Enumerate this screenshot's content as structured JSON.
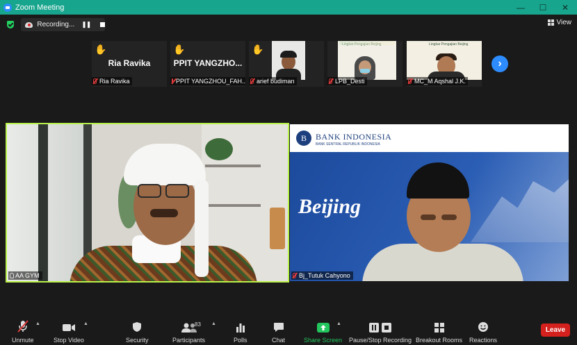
{
  "window": {
    "title": "Zoom Meeting"
  },
  "recording": {
    "status": "Recording..."
  },
  "topbar": {
    "view_label": "View"
  },
  "thumbnails": [
    {
      "big_name": "Ria  Ravika",
      "label": "Ria  Ravika",
      "raised_hand": true
    },
    {
      "big_name": "PPIT YANGZHO...",
      "label": "PPIT YANGZHOU_FAH...",
      "raised_hand": true
    },
    {
      "big_name": "",
      "label": "arief budiman",
      "raised_hand": true
    },
    {
      "big_name": "",
      "label": "LPB_Desti",
      "raised_hand": false,
      "banner_text": "Lingkar Pengajian Beijing"
    },
    {
      "big_name": "",
      "label": "MC_M Aqshal J.K.",
      "raised_hand": false,
      "banner_text": "Lingkar Pengajian Beijing"
    }
  ],
  "main_videos": [
    {
      "label": "AA GYM"
    },
    {
      "label": "Bj_Tutuk Cahyono",
      "bank_name": "BANK INDONESIA",
      "bank_sub": "BANK SENTRAL REPUBLIK INDONESIA",
      "city_text": "Beijing"
    }
  ],
  "toolbar": {
    "unmute": "Unmute",
    "stop_video": "Stop Video",
    "security": "Security",
    "participants": "Participants",
    "participants_count": "83",
    "polls": "Polls",
    "chat": "Chat",
    "share_screen": "Share Screen",
    "recording": "Pause/Stop Recording",
    "breakout": "Breakout Rooms",
    "reactions": "Reactions",
    "leave": "Leave"
  },
  "colors": {
    "titlebar": "#18a58d",
    "active_speaker": "#b9f24a",
    "leave": "#d4211d",
    "share": "#23c55e",
    "accent": "#2d8cff"
  }
}
